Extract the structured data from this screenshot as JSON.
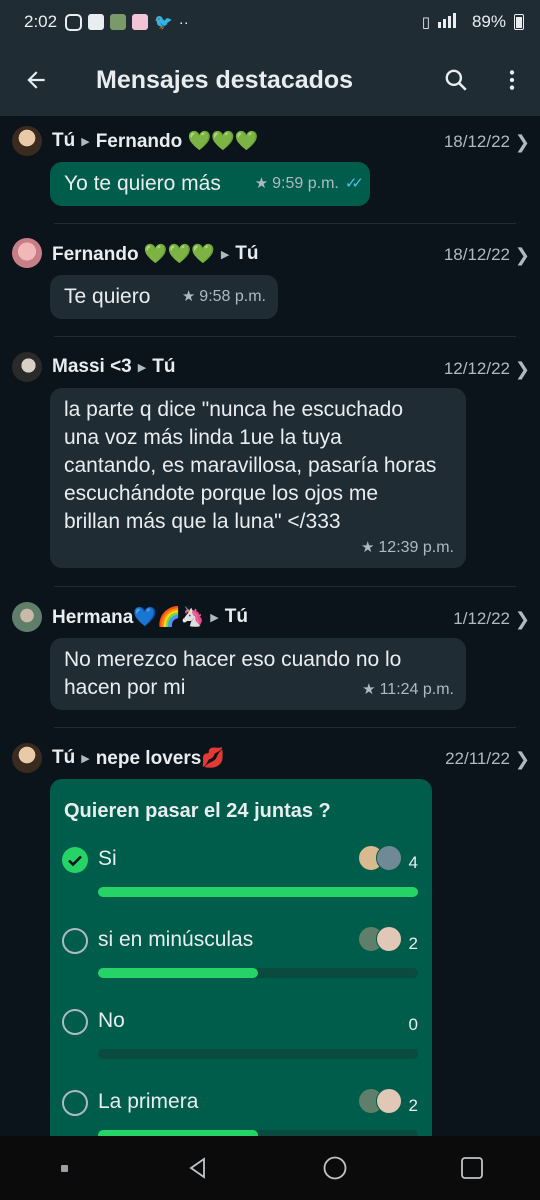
{
  "status_bar": {
    "time": "2:02",
    "battery": "89%"
  },
  "header": {
    "title": "Mensajes destacados"
  },
  "messages": [
    {
      "sender": "Tú",
      "recipient": "Fernando 💚💚💚",
      "date": "18/12/22",
      "text": "Yo te quiero más",
      "time": "9:59 p.m."
    },
    {
      "sender": "Fernando 💚💚💚",
      "recipient": "Tú",
      "date": "18/12/22",
      "text": "Te quiero",
      "time": "9:58 p.m."
    },
    {
      "sender": "Massi <3",
      "recipient": "Tú",
      "date": "12/12/22",
      "lines": [
        "la parte q dice \"nunca he escuchado",
        "una voz más linda 1ue la tuya",
        "cantando, es maravillosa, pasaría horas",
        "escuchándote porque los ojos me",
        "brillan más que la luna\" </333"
      ],
      "time": "12:39 p.m."
    },
    {
      "sender": "Hermana💙🌈🦄",
      "recipient": "Tú",
      "date": "1/12/22",
      "lines": [
        "No merezco hacer eso cuando no lo",
        "hacen por mi"
      ],
      "time": "11:24 p.m."
    },
    {
      "sender": "Tú",
      "recipient": "nepe lovers💋",
      "date": "22/11/22"
    }
  ],
  "poll": {
    "question": "Quieren pasar el 24 juntas ?",
    "options": [
      {
        "label": "Si",
        "count": "4",
        "fraction": 1.0,
        "selected": true
      },
      {
        "label": "si en minúsculas",
        "count": "2",
        "fraction": 0.5,
        "selected": false
      },
      {
        "label": "No",
        "count": "0",
        "fraction": 0.0,
        "selected": false
      },
      {
        "label": "La primera",
        "count": "2",
        "fraction": 0.5,
        "selected": false
      }
    ]
  },
  "colors": {
    "background": "#0b141a",
    "outgoing_bubble": "#005c4b",
    "incoming_bubble": "#1f2c34",
    "accent": "#25d366",
    "read_ticks": "#53bdeb"
  }
}
